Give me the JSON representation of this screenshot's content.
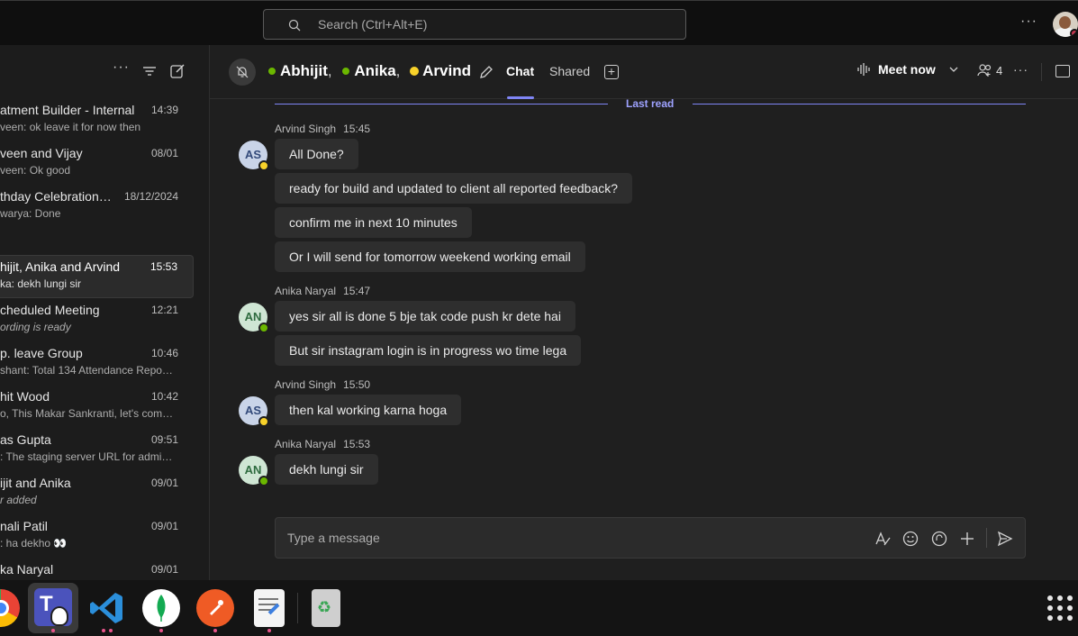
{
  "topbar": {
    "search_placeholder": "Search (Ctrl+Alt+E)",
    "more_label": "···"
  },
  "sidebar": {
    "chats": [
      {
        "name": "atment Builder - Internal",
        "time": "14:39",
        "preview": "veen: ok leave it for now then",
        "italic": false
      },
      {
        "name": "veen and Vijay",
        "time": "08/01",
        "preview": "veen: Ok good",
        "italic": false
      },
      {
        "name": "thday Celebration…",
        "time": "18/12/2024",
        "preview": "warya: Done",
        "italic": false
      },
      {
        "name": "hijit, Anika and Arvind",
        "time": "15:53",
        "preview": "ka: dekh lungi sir",
        "italic": false,
        "active": true
      },
      {
        "name": "cheduled Meeting",
        "time": "12:21",
        "preview": "ording is ready",
        "italic": true
      },
      {
        "name": "p. leave Group",
        "time": "10:46",
        "preview": "shant: Total 134   Attendance Repo…",
        "italic": false
      },
      {
        "name": "hit Wood",
        "time": "10:42",
        "preview": "o, This Makar Sankranti, let's com…",
        "italic": false
      },
      {
        "name": "as Gupta",
        "time": "09:51",
        "preview": ": The staging server URL for admin…",
        "italic": false
      },
      {
        "name": "ijit and Anika",
        "time": "09/01",
        "preview": "r added",
        "italic": true
      },
      {
        "name": "nali Patil",
        "time": "09/01",
        "preview": ": ha dekho 👀",
        "italic": false
      },
      {
        "name": "ka Naryal",
        "time": "09/01",
        "preview": "",
        "italic": false
      }
    ]
  },
  "header": {
    "participants": [
      "Abhijit",
      "Anika",
      "Arvind"
    ],
    "separator": ",",
    "tabs": {
      "chat": "Chat",
      "shared": "Shared"
    },
    "meet_now": "Meet now",
    "people_count": "4",
    "more": "···"
  },
  "conversation": {
    "last_read": "Last read",
    "groups": [
      {
        "sender": "Arvind Singh",
        "time": "15:45",
        "initials": "AS",
        "status": "away",
        "messages": [
          "All Done?",
          "ready for build and updated to client all reported feedback?",
          "confirm me in next 10 minutes",
          "Or I will send for tomorrow weekend working email"
        ]
      },
      {
        "sender": "Anika Naryal",
        "time": "15:47",
        "initials": "AN",
        "status": "available",
        "messages": [
          "yes sir all is done 5 bje tak code push kr dete hai",
          "But sir instagram login is in progress wo time lega"
        ]
      },
      {
        "sender": "Arvind Singh",
        "time": "15:50",
        "initials": "AS",
        "status": "away",
        "messages": [
          "then kal working karna hoga"
        ]
      },
      {
        "sender": "Anika Naryal",
        "time": "15:53",
        "initials": "AN",
        "status": "available",
        "messages": [
          "dekh lungi sir"
        ]
      }
    ]
  },
  "composer": {
    "placeholder": "Type a message"
  },
  "colors": {
    "accent": "#7f85f5",
    "available": "#6bb700",
    "away": "#f8d22a"
  },
  "dock": {
    "apps": [
      "chrome-icon",
      "teams-icon",
      "vscode-icon",
      "mongodb-compass-icon",
      "postman-icon",
      "text-editor-icon",
      "trash-icon"
    ]
  }
}
